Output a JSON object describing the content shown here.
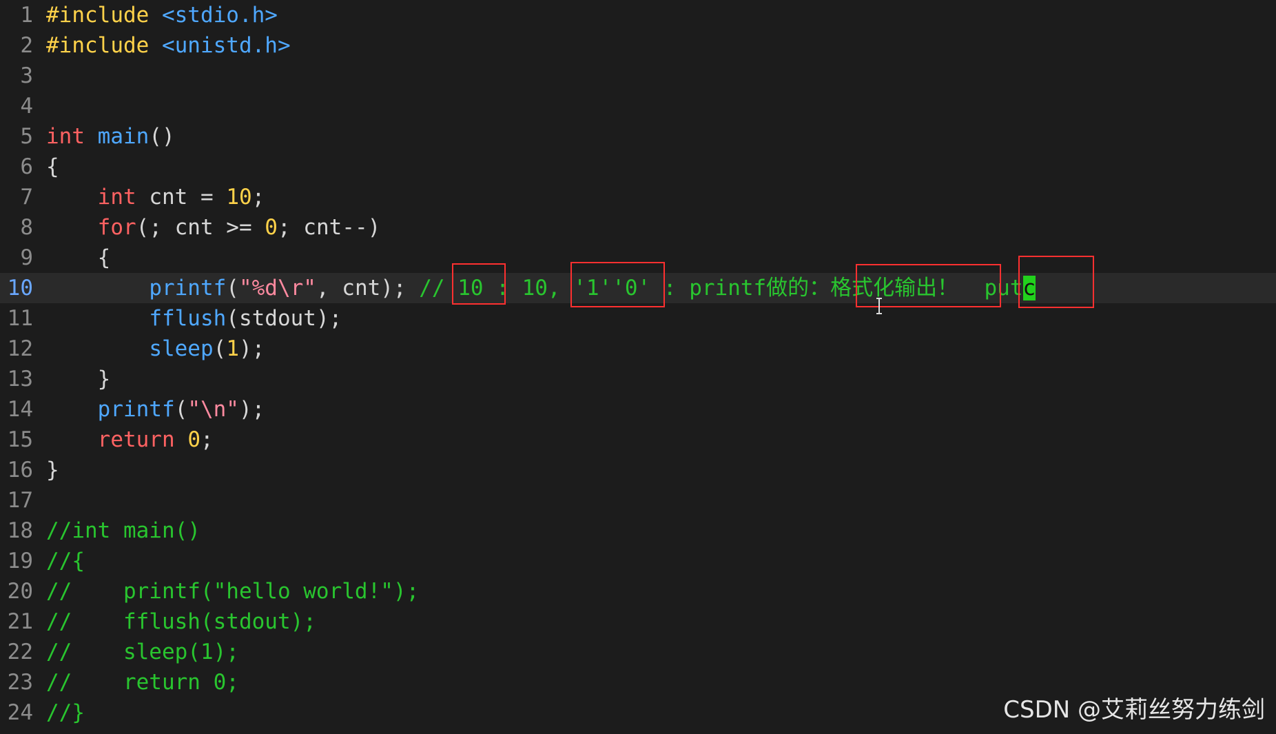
{
  "colors": {
    "background": "#1c1c1c",
    "line_number": "#8c8c8c",
    "current_line_number": "#6aa7ff",
    "keyword": "#ff6262",
    "function": "#4fa8ff",
    "string": "#ff8aa0",
    "number": "#ffd24a",
    "comment": "#29c52f",
    "plain": "#d7d7d7",
    "annotation_box": "#ff3030",
    "cursor": "#22d11d"
  },
  "editor": {
    "current_line": 10,
    "cursor_char": "c",
    "lines": [
      {
        "n": "1",
        "tokens": [
          {
            "t": "#include ",
            "c": "number"
          },
          {
            "t": "<stdio.h>",
            "c": "function"
          }
        ]
      },
      {
        "n": "2",
        "tokens": [
          {
            "t": "#include ",
            "c": "number"
          },
          {
            "t": "<unistd.h>",
            "c": "function"
          }
        ]
      },
      {
        "n": "3",
        "tokens": []
      },
      {
        "n": "4",
        "tokens": []
      },
      {
        "n": "5",
        "tokens": [
          {
            "t": "int",
            "c": "keyword"
          },
          {
            "t": " ",
            "c": "plain"
          },
          {
            "t": "main",
            "c": "function"
          },
          {
            "t": "()",
            "c": "plain"
          }
        ]
      },
      {
        "n": "6",
        "tokens": [
          {
            "t": "{",
            "c": "plain"
          }
        ]
      },
      {
        "n": "7",
        "tokens": [
          {
            "t": "    ",
            "c": "plain"
          },
          {
            "t": "int",
            "c": "keyword"
          },
          {
            "t": " cnt = ",
            "c": "plain"
          },
          {
            "t": "10",
            "c": "number"
          },
          {
            "t": ";",
            "c": "plain"
          }
        ]
      },
      {
        "n": "8",
        "tokens": [
          {
            "t": "    ",
            "c": "plain"
          },
          {
            "t": "for",
            "c": "keyword"
          },
          {
            "t": "(; cnt >= ",
            "c": "plain"
          },
          {
            "t": "0",
            "c": "number"
          },
          {
            "t": "; cnt--)",
            "c": "plain"
          }
        ]
      },
      {
        "n": "9",
        "tokens": [
          {
            "t": "    {",
            "c": "plain"
          }
        ]
      },
      {
        "n": "10",
        "tokens": [
          {
            "t": "        ",
            "c": "plain"
          },
          {
            "t": "printf",
            "c": "function"
          },
          {
            "t": "(",
            "c": "plain"
          },
          {
            "t": "\"%d\\r\"",
            "c": "string"
          },
          {
            "t": ", cnt); ",
            "c": "plain"
          },
          {
            "t": "// 10 : 10, '1''0' : printf做的：格式化输出！  put",
            "c": "comment"
          },
          {
            "t": "c",
            "c": "cursor"
          }
        ]
      },
      {
        "n": "11",
        "tokens": [
          {
            "t": "        ",
            "c": "plain"
          },
          {
            "t": "fflush",
            "c": "function"
          },
          {
            "t": "(stdout);",
            "c": "plain"
          }
        ]
      },
      {
        "n": "12",
        "tokens": [
          {
            "t": "        ",
            "c": "plain"
          },
          {
            "t": "sleep",
            "c": "function"
          },
          {
            "t": "(",
            "c": "plain"
          },
          {
            "t": "1",
            "c": "number"
          },
          {
            "t": ");",
            "c": "plain"
          }
        ]
      },
      {
        "n": "13",
        "tokens": [
          {
            "t": "    }",
            "c": "plain"
          }
        ]
      },
      {
        "n": "14",
        "tokens": [
          {
            "t": "    ",
            "c": "plain"
          },
          {
            "t": "printf",
            "c": "function"
          },
          {
            "t": "(",
            "c": "plain"
          },
          {
            "t": "\"\\n\"",
            "c": "string"
          },
          {
            "t": ");",
            "c": "plain"
          }
        ]
      },
      {
        "n": "15",
        "tokens": [
          {
            "t": "    ",
            "c": "plain"
          },
          {
            "t": "return",
            "c": "keyword"
          },
          {
            "t": " ",
            "c": "plain"
          },
          {
            "t": "0",
            "c": "number"
          },
          {
            "t": ";",
            "c": "plain"
          }
        ]
      },
      {
        "n": "16",
        "tokens": [
          {
            "t": "}",
            "c": "plain"
          }
        ]
      },
      {
        "n": "17",
        "tokens": []
      },
      {
        "n": "18",
        "tokens": [
          {
            "t": "//int main()",
            "c": "comment"
          }
        ]
      },
      {
        "n": "19",
        "tokens": [
          {
            "t": "//{",
            "c": "comment"
          }
        ]
      },
      {
        "n": "20",
        "tokens": [
          {
            "t": "//    printf(\"hello world!\");",
            "c": "comment"
          }
        ]
      },
      {
        "n": "21",
        "tokens": [
          {
            "t": "//    fflush(stdout);",
            "c": "comment"
          }
        ]
      },
      {
        "n": "22",
        "tokens": [
          {
            "t": "//    sleep(1);",
            "c": "comment"
          }
        ]
      },
      {
        "n": "23",
        "tokens": [
          {
            "t": "//    return 0;",
            "c": "comment"
          }
        ]
      },
      {
        "n": "24",
        "tokens": [
          {
            "t": "//}",
            "c": "comment"
          }
        ]
      }
    ]
  },
  "annotations": [
    "10",
    "'1''0'",
    "格式化输出！",
    "putc"
  ],
  "watermark": "CSDN @艾莉丝努力练剑"
}
